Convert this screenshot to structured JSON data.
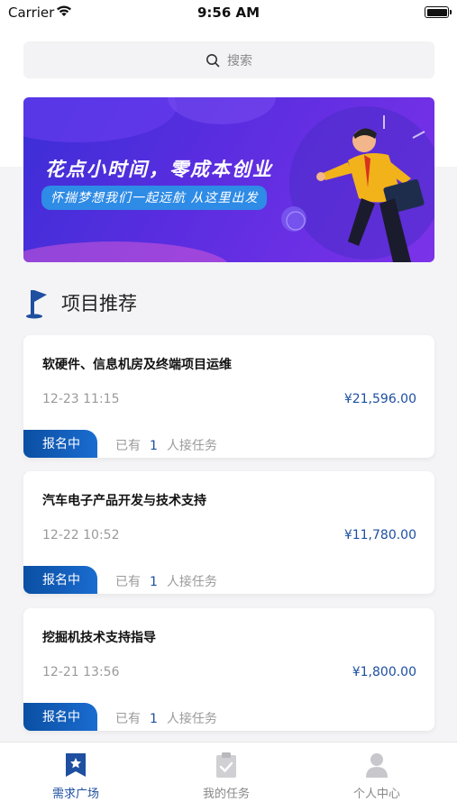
{
  "status_bar": {
    "carrier": "Carrier",
    "time": "9:56 AM"
  },
  "search": {
    "placeholder": "搜索"
  },
  "banner": {
    "title": "花点小时间，零成本创业",
    "subtitle": "怀揣梦想我们一起远航 从这里出发"
  },
  "section": {
    "title": "项目推荐"
  },
  "projects": [
    {
      "title": "软硬件、信息机房及终端项目运维",
      "time": "12-23 11:15",
      "price": "¥21,596.00",
      "status": "报名中",
      "prefix": "已有",
      "count": "1",
      "suffix": "人接任务"
    },
    {
      "title": "汽车电子产品开发与技术支持",
      "time": "12-22 10:52",
      "price": "¥11,780.00",
      "status": "报名中",
      "prefix": "已有",
      "count": "1",
      "suffix": "人接任务"
    },
    {
      "title": "挖掘机技术支持指导",
      "time": "12-21 13:56",
      "price": "¥1,800.00",
      "status": "报名中",
      "prefix": "已有",
      "count": "1",
      "suffix": "人接任务"
    }
  ],
  "tabs": [
    {
      "label": "需求广场",
      "icon": "star-bookmark-icon",
      "active": true
    },
    {
      "label": "我的任务",
      "icon": "clipboard-check-icon",
      "active": false
    },
    {
      "label": "个人中心",
      "icon": "person-icon",
      "active": false
    }
  ],
  "colors": {
    "accent": "#1e4fa0",
    "badge": "#0a4fa3",
    "banner": "#4a2fdc"
  }
}
